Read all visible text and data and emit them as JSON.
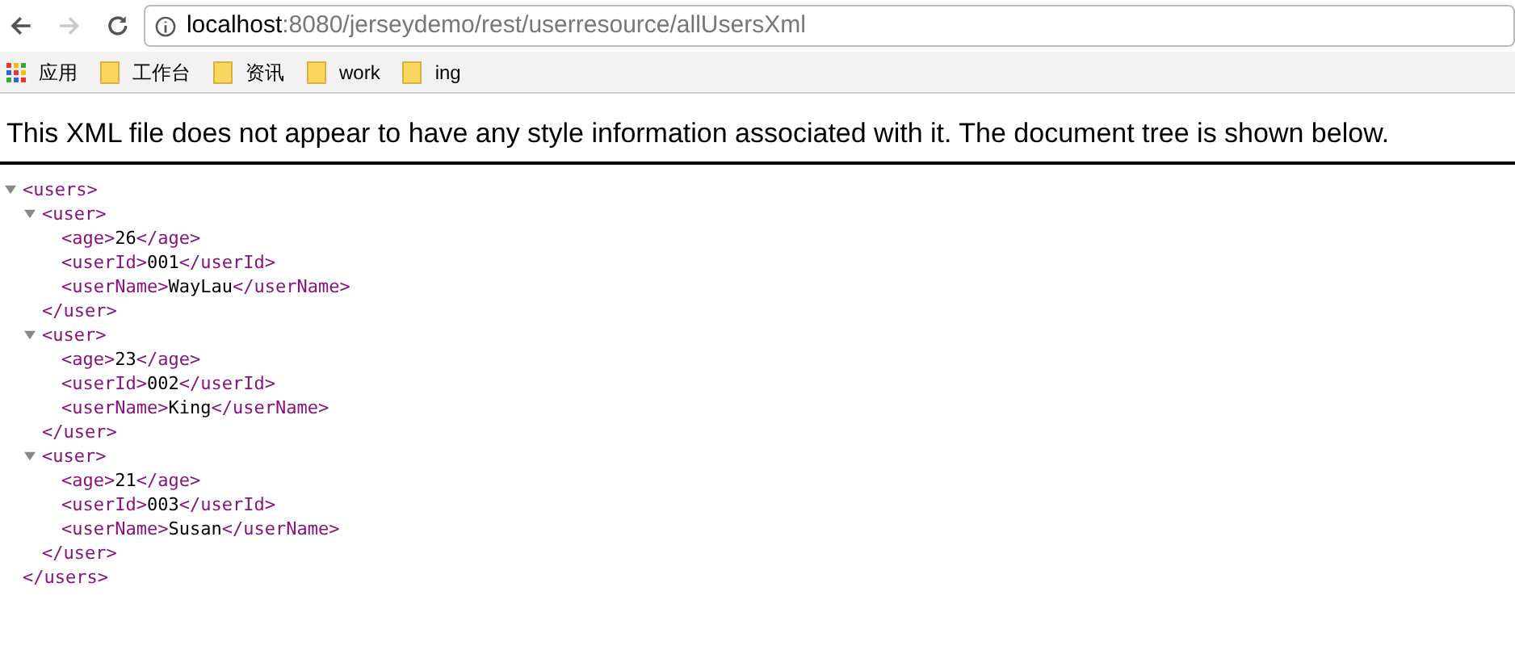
{
  "address_bar": {
    "host": "localhost",
    "path": ":8080/jerseydemo/rest/userresource/allUsersXml"
  },
  "bookmarks": [
    {
      "kind": "apps",
      "label": "应用"
    },
    {
      "kind": "folder",
      "label": "工作台"
    },
    {
      "kind": "folder",
      "label": "资讯"
    },
    {
      "kind": "folder",
      "label": "work"
    },
    {
      "kind": "folder",
      "label": "ing"
    }
  ],
  "notice": "This XML file does not appear to have any style information associated with it. The document tree is shown below.",
  "xml_tree": {
    "open": "<users>",
    "close": "</users>",
    "expanded": true,
    "children": [
      {
        "open": "<user>",
        "close": "</user>",
        "expanded": true,
        "children": [
          {
            "open": "<age>",
            "value": "26",
            "close": "</age>"
          },
          {
            "open": "<userId>",
            "value": "001",
            "close": "</userId>"
          },
          {
            "open": "<userName>",
            "value": "WayLau",
            "close": "</userName>"
          }
        ]
      },
      {
        "open": "<user>",
        "close": "</user>",
        "expanded": true,
        "children": [
          {
            "open": "<age>",
            "value": "23",
            "close": "</age>"
          },
          {
            "open": "<userId>",
            "value": "002",
            "close": "</userId>"
          },
          {
            "open": "<userName>",
            "value": "King",
            "close": "</userName>"
          }
        ]
      },
      {
        "open": "<user>",
        "close": "</user>",
        "expanded": true,
        "children": [
          {
            "open": "<age>",
            "value": "21",
            "close": "</age>"
          },
          {
            "open": "<userId>",
            "value": "003",
            "close": "</userId>"
          },
          {
            "open": "<userName>",
            "value": "Susan",
            "close": "</userName>"
          }
        ]
      }
    ]
  }
}
